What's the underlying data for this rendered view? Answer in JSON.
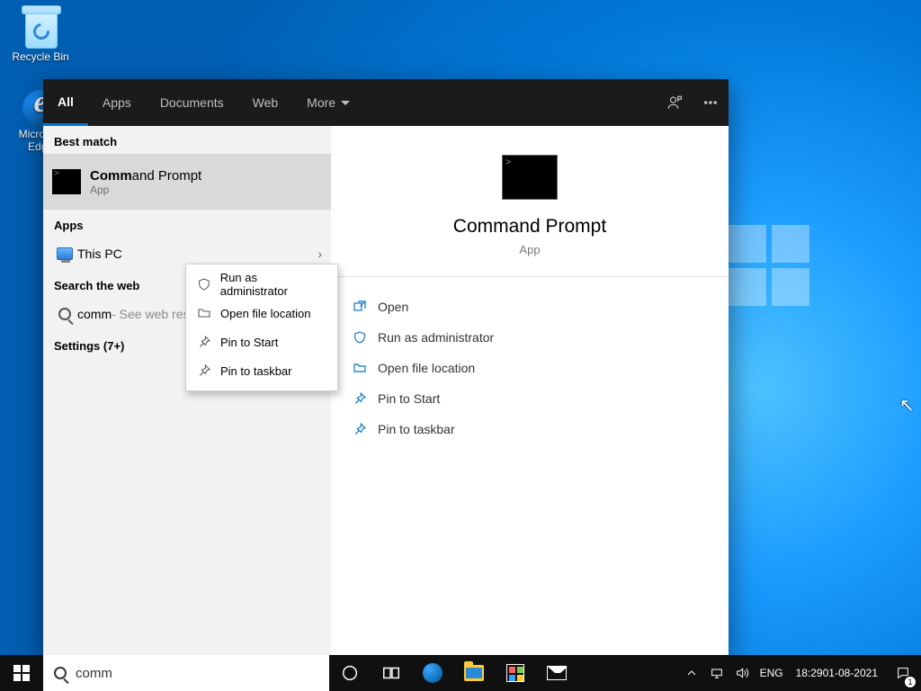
{
  "desktop": {
    "recycle": "Recycle Bin",
    "edge": "Microsoft Edge"
  },
  "searchPanel": {
    "tabs": {
      "all": "All",
      "apps": "Apps",
      "documents": "Documents",
      "web": "Web",
      "more": "More"
    },
    "sections": {
      "bestMatch": "Best match",
      "apps": "Apps",
      "searchWeb": "Search the web",
      "settings": "Settings (7+)"
    },
    "bestMatch": {
      "titlePrefix": "Comm",
      "titleRest": "and Prompt",
      "subtitle": "App"
    },
    "appsList": {
      "thisPC": "This PC"
    },
    "webSearch": {
      "query": "comm",
      "hint": " - See web results"
    },
    "contextMenu": {
      "runAdmin": "Run as administrator",
      "openLoc": "Open file location",
      "pinStart": "Pin to Start",
      "pinTaskbar": "Pin to taskbar"
    },
    "preview": {
      "title": "Command Prompt",
      "subtitle": "App",
      "actions": {
        "open": "Open",
        "runAdmin": "Run as administrator",
        "openLoc": "Open file location",
        "pinStart": "Pin to Start",
        "pinTaskbar": "Pin to taskbar"
      }
    }
  },
  "taskbar": {
    "searchValue": "comm",
    "lang": "ENG",
    "time": "18:29",
    "date": "01-08-2021",
    "notifCount": "1"
  }
}
